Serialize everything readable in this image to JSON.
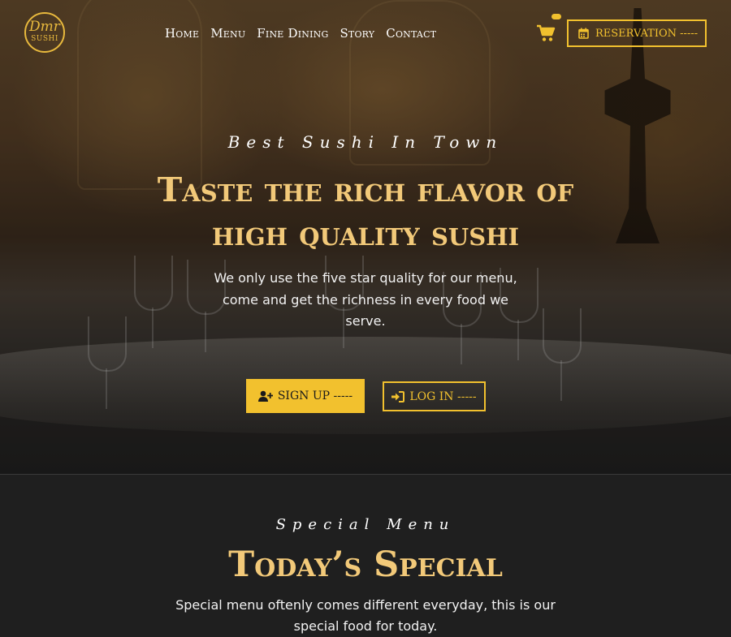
{
  "brand": {
    "logo_line1": "Dmr",
    "logo_line2": "SUSHI",
    "accent": "#f2c12e",
    "title_color": "#f2c979"
  },
  "nav": {
    "items": [
      {
        "label": "Home"
      },
      {
        "label": "Menu"
      },
      {
        "label": "Fine Dining"
      },
      {
        "label": "Story"
      },
      {
        "label": "Contact"
      }
    ]
  },
  "header": {
    "cart_icon": "shopping-cart-icon",
    "reservation_icon": "calendar-icon",
    "reservation_label": "RESERVATION -----"
  },
  "hero": {
    "kicker": "Best Sushi In Town",
    "title_line1": "Taste the rich flavor of",
    "title_line2": "high quality sushi",
    "description": "We only use the five star quality for our menu, come and get the richness in every food we serve.",
    "signup_icon": "user-plus-icon",
    "signup_label": "SIGN UP -----",
    "login_icon": "sign-in-icon",
    "login_label": "LOG IN -----"
  },
  "special": {
    "kicker": "Special Menu",
    "title": "Today’s Special",
    "description": "Special menu oftenly comes different everyday, this is our special food for today."
  }
}
